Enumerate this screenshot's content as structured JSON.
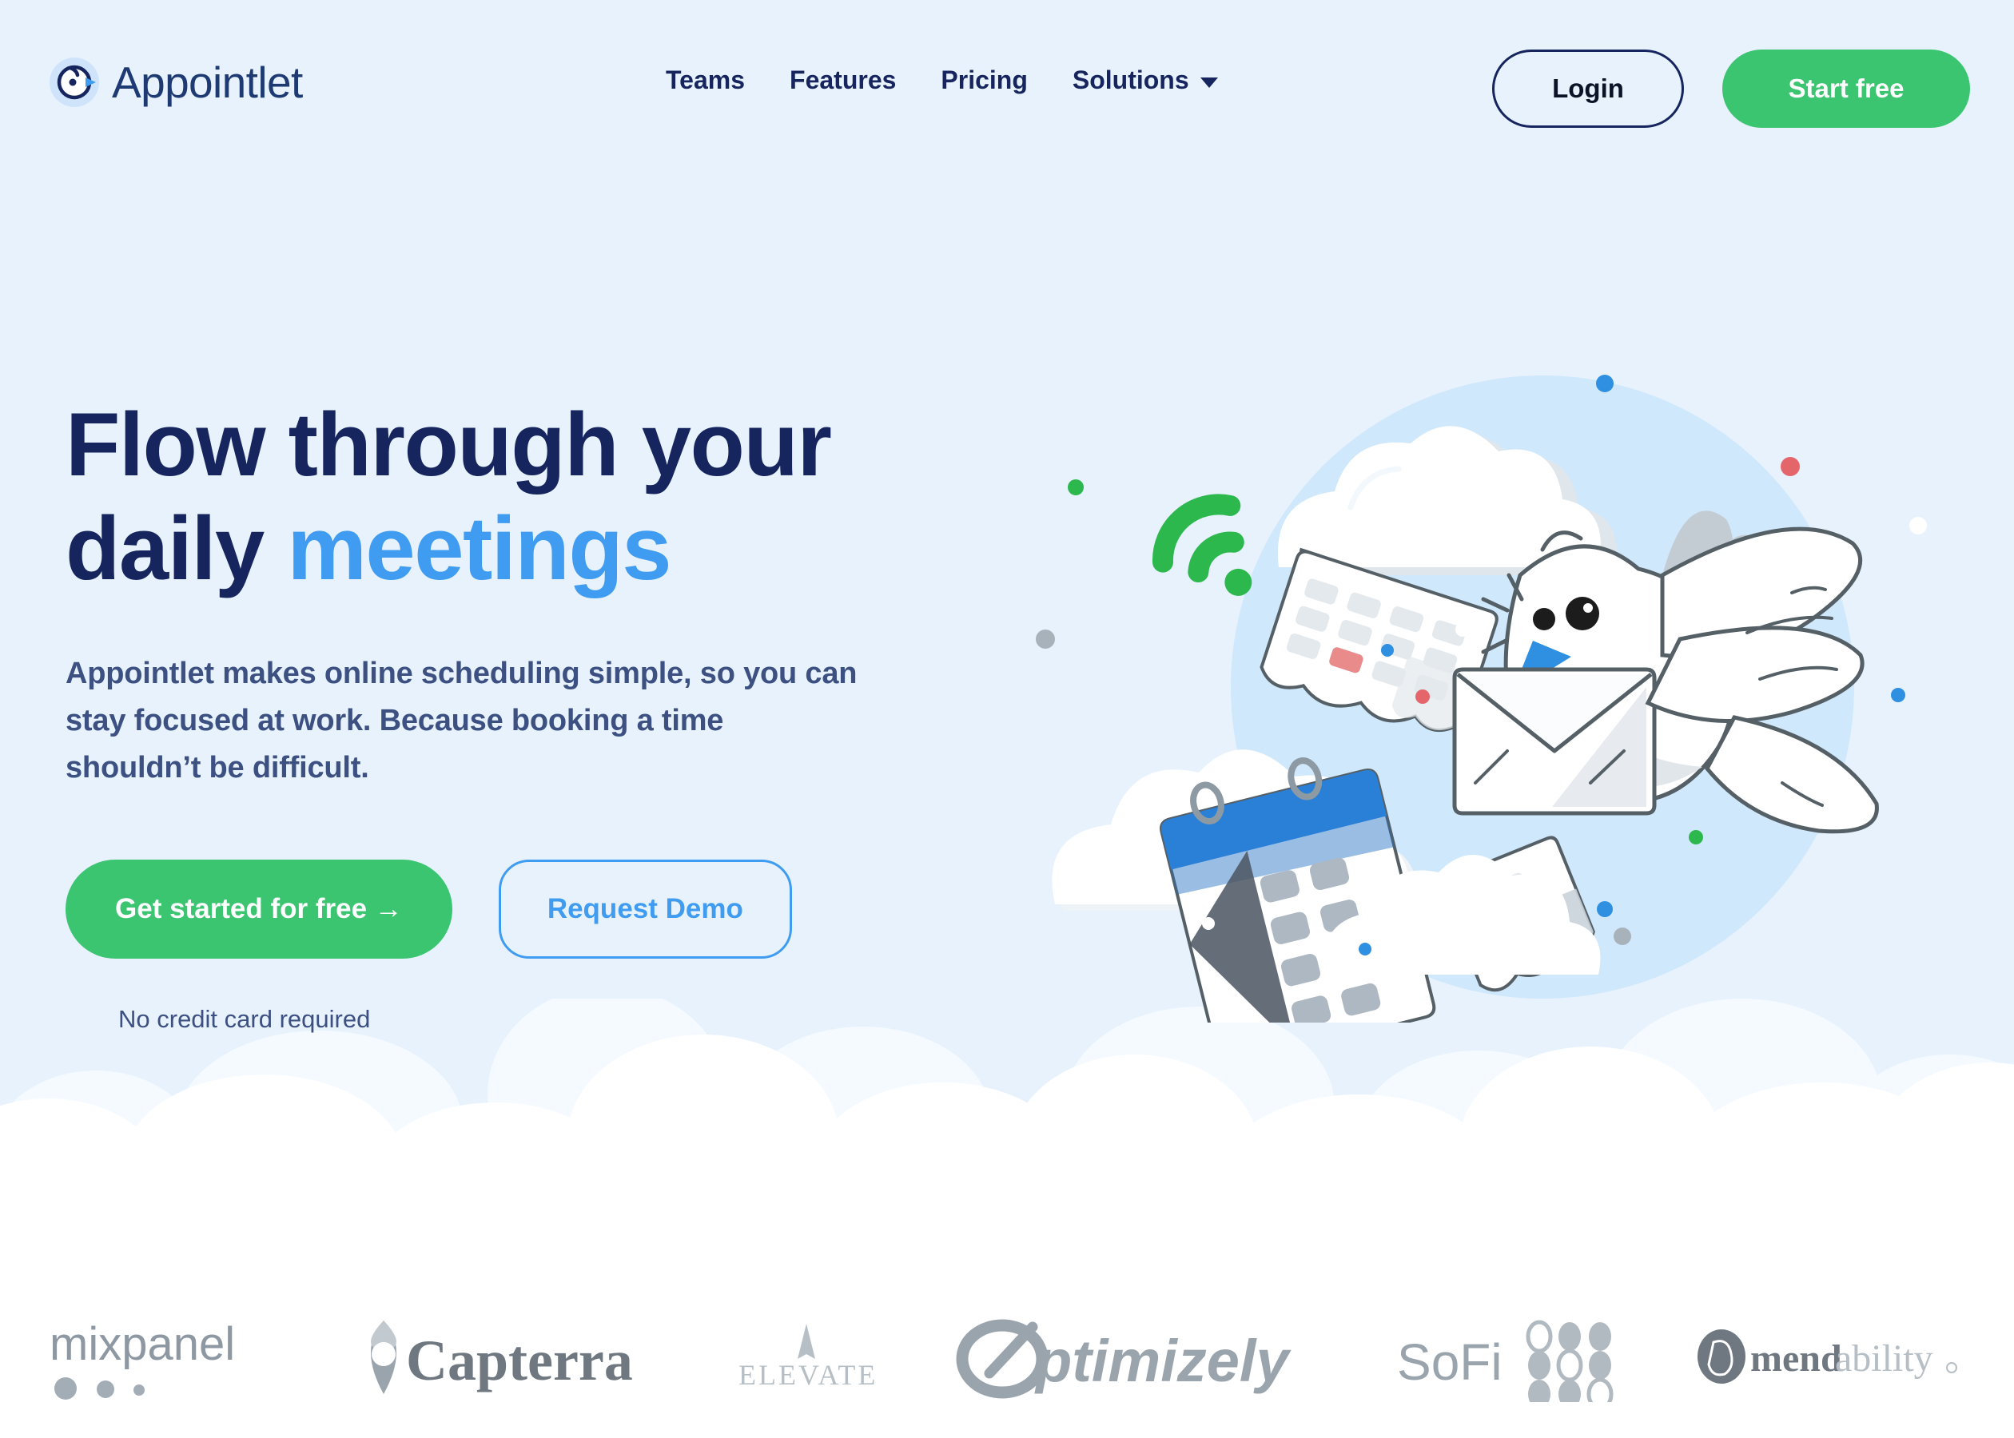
{
  "brand": {
    "name": "Appointlet",
    "logo_icon": "bird-head-icon",
    "navy": "#16255e",
    "blue": "#3f9cf0",
    "green": "#3cc571",
    "hero_bg": "#e7f2fd"
  },
  "nav": {
    "items": [
      {
        "label": "Teams",
        "has_dropdown": false
      },
      {
        "label": "Features",
        "has_dropdown": false
      },
      {
        "label": "Pricing",
        "has_dropdown": false
      },
      {
        "label": "Solutions",
        "has_dropdown": true
      }
    ],
    "login_label": "Login",
    "start_free_label": "Start free"
  },
  "hero": {
    "headline_part1": "Flow through your daily ",
    "headline_accent": "meetings",
    "subcopy": "Appointlet makes online scheduling simple, so you can stay focused at work. Because booking a time shouldn’t be difficult.",
    "primary_cta": "Get started for free →",
    "secondary_cta": "Request Demo",
    "fine_print": "No credit card required",
    "illustration": "dove-carrying-envelope-with-calendars-and-clouds"
  },
  "logos": {
    "items": [
      {
        "name": "mixpanel",
        "label": "mixpanel"
      },
      {
        "name": "capterra",
        "label": "Capterra"
      },
      {
        "name": "elevate",
        "label": "ELEVATE"
      },
      {
        "name": "optimizely",
        "label": "ptimizely"
      },
      {
        "name": "sofi",
        "label": "SoFi"
      },
      {
        "name": "mendability",
        "label_dark": "mend",
        "label_light": "ability"
      }
    ]
  }
}
